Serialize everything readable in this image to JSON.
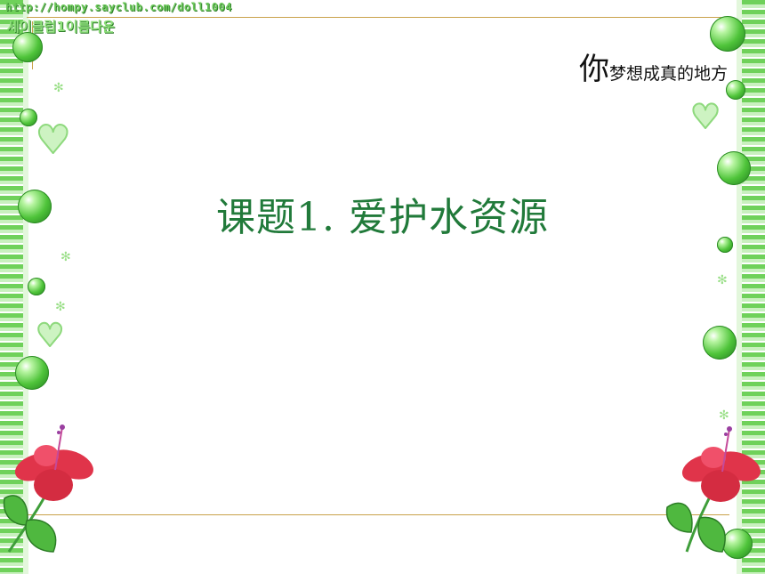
{
  "header": {
    "url_text": "http://hompy.sayclub.com/doll1004",
    "korean_text": "세이클럽1이름다운"
  },
  "corner_title": {
    "first_char": "你",
    "rest": "梦想成真的地方"
  },
  "main_title": "课题1. 爱护水资源",
  "colors": {
    "title_green": "#217a3a",
    "border_green": "#6fd15a",
    "rule_gold": "#c9a24a",
    "flower_red": "#e0344a",
    "leaf_green": "#3f9e3a"
  },
  "decorations": {
    "left_flower": "hibiscus-flower-icon",
    "right_flower": "hibiscus-flower-icon",
    "bubbles": "green-bubble-icon",
    "hearts": "heart-icon"
  }
}
